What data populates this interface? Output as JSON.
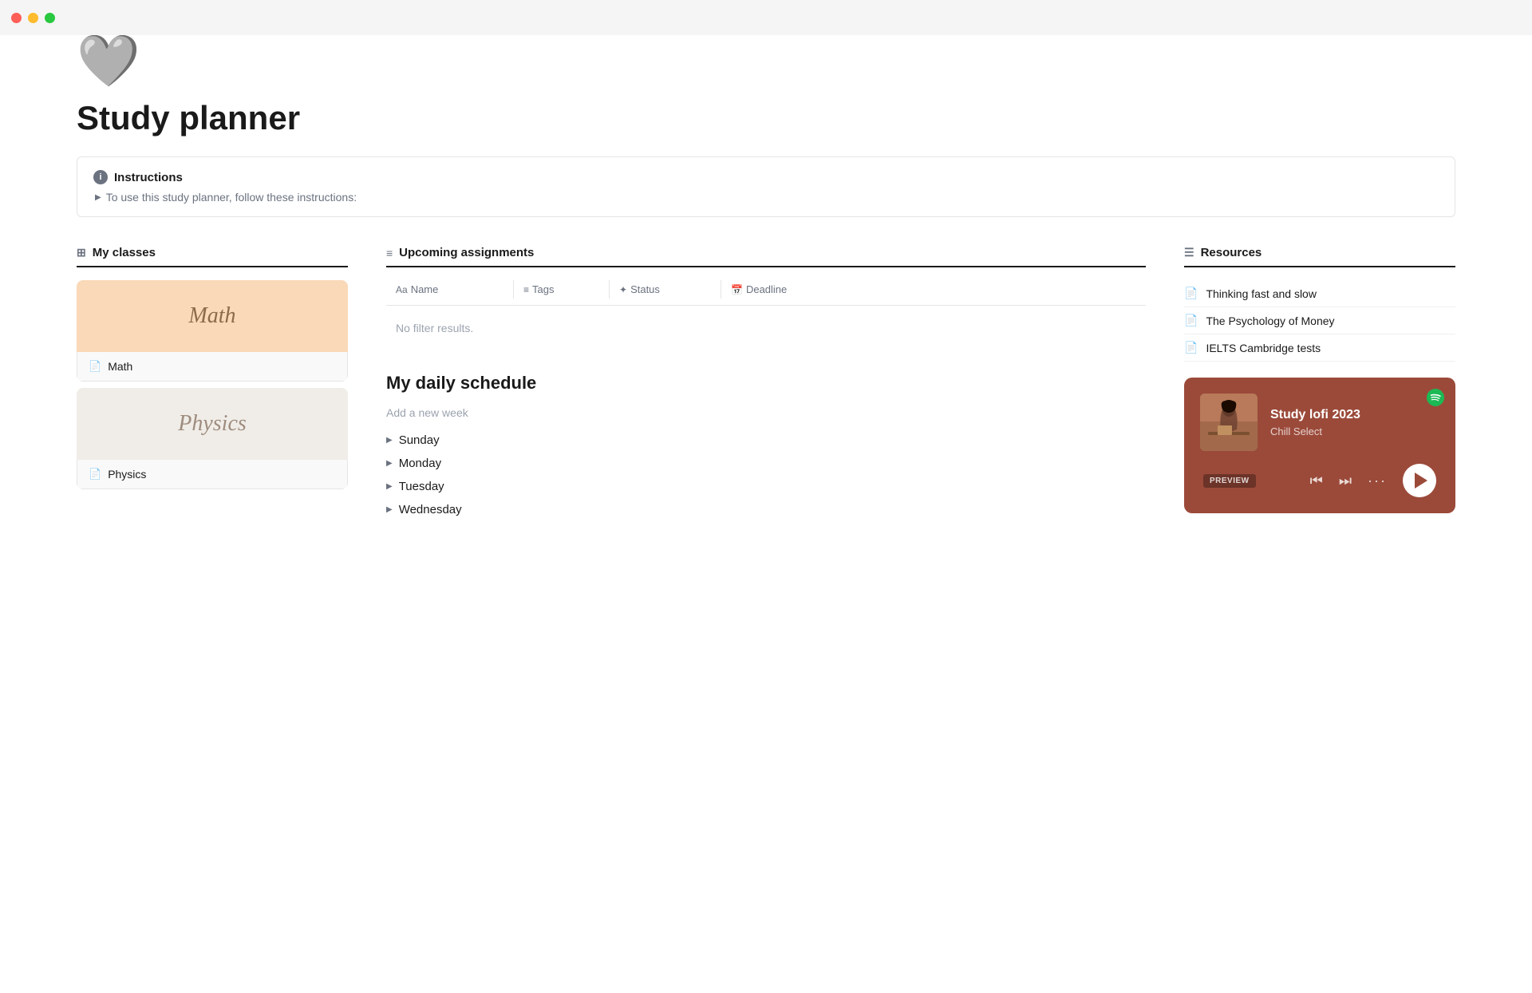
{
  "titlebar": {
    "close": "close",
    "minimize": "minimize",
    "maximize": "maximize"
  },
  "page": {
    "icon": "🤍",
    "title": "Study planner"
  },
  "instructions": {
    "header": "Instructions",
    "toggle_text": "To use this study planner, follow these instructions:"
  },
  "classes": {
    "header": "My classes",
    "items": [
      {
        "name": "Math",
        "style": "math-bg",
        "script_name": "Math"
      },
      {
        "name": "Physics",
        "style": "physics-bg",
        "script_name": "Physics"
      }
    ]
  },
  "assignments": {
    "header": "Upcoming assignments",
    "columns": [
      "Name",
      "Tags",
      "Status",
      "Deadline"
    ],
    "no_results": "No filter results."
  },
  "schedule": {
    "title": "My daily schedule",
    "add_label": "Add a new week",
    "days": [
      "Sunday",
      "Monday",
      "Tuesday",
      "Wednesday"
    ]
  },
  "resources": {
    "header": "Resources",
    "items": [
      "Thinking fast and slow",
      "The Psychology of Money",
      "IELTS Cambridge tests"
    ]
  },
  "spotify": {
    "track": "Study lofi 2023",
    "artist": "Chill Select",
    "preview_label": "PREVIEW",
    "logo_label": "Spotify"
  }
}
